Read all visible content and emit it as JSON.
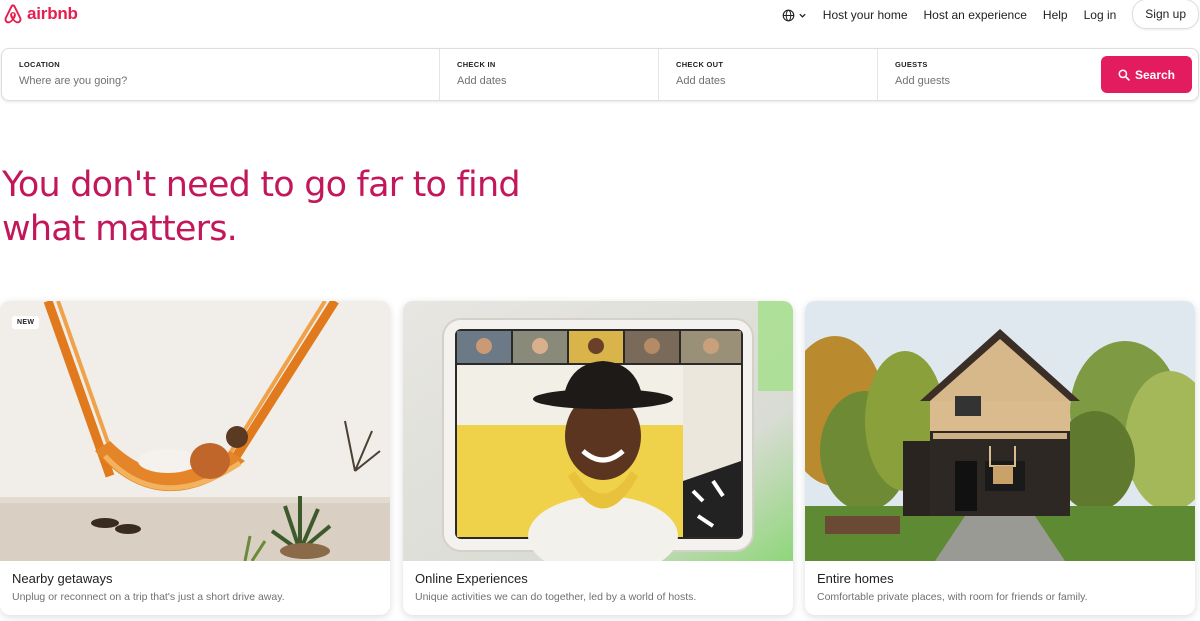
{
  "brand": {
    "name": "airbnb",
    "color": "#e61e4d"
  },
  "nav": {
    "language_icon": "globe-icon",
    "links": [
      "Host your home",
      "Host an experience",
      "Help",
      "Log in"
    ],
    "signup_label": "Sign up"
  },
  "search": {
    "location": {
      "label": "LOCATION",
      "placeholder": "Where are you going?"
    },
    "check_in": {
      "label": "CHECK IN",
      "placeholder": "Add dates"
    },
    "check_out": {
      "label": "CHECK OUT",
      "placeholder": "Add dates"
    },
    "guests": {
      "label": "GUESTS",
      "placeholder": "Add guests"
    },
    "button_label": "Search",
    "button_color": "#e31c5f"
  },
  "hero": {
    "line1": "You don't need to go far to find",
    "line2": "what matters.",
    "color": "#c2185b"
  },
  "cards": [
    {
      "badge": "NEW",
      "title": "Nearby getaways",
      "subtitle": "Unplug or reconnect on a trip that's just a short drive away."
    },
    {
      "title": "Online Experiences",
      "subtitle": "Unique activities we can do together, led by a world of hosts."
    },
    {
      "title": "Entire homes",
      "subtitle": "Comfortable private places, with room for friends or family."
    }
  ]
}
